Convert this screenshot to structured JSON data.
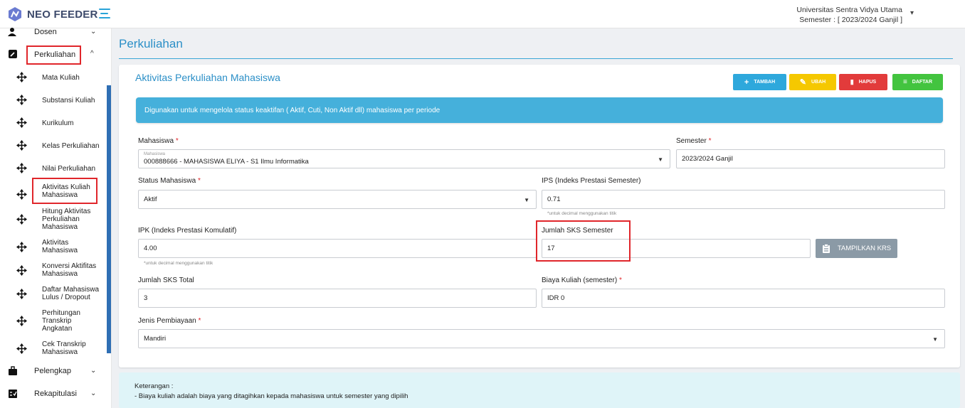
{
  "app": {
    "name": "NEO FEEDER"
  },
  "header": {
    "institution": "Universitas Sentra Vidya Utama",
    "semester": "Semester : [ 2023/2024 Ganjil ]"
  },
  "sidebar": {
    "items": [
      {
        "label": "Dosen",
        "icon": "user-group-icon"
      },
      {
        "label": "Perkuliahan",
        "icon": "edit-square-icon"
      },
      {
        "label": "Pelengkap",
        "icon": "briefcase-icon"
      },
      {
        "label": "Rekapitulasi",
        "icon": "report-icon"
      }
    ],
    "subitems": [
      {
        "label": "Mata Kuliah"
      },
      {
        "label": "Substansi Kuliah"
      },
      {
        "label": "Kurikulum"
      },
      {
        "label": "Kelas Perkuliahan"
      },
      {
        "label": "Nilai Perkuliahan"
      },
      {
        "label": "Aktivitas Kuliah Mahasiswa"
      },
      {
        "label": "Hitung Aktivitas Perkuliahan Mahasiswa"
      },
      {
        "label": "Aktivitas Mahasiswa"
      },
      {
        "label": "Konversi Aktifitas Mahasiswa"
      },
      {
        "label": "Daftar Mahasiswa Lulus / Dropout"
      },
      {
        "label": "Perhitungan Transkrip Angkatan"
      },
      {
        "label": "Cek Transkrip Mahasiswa"
      }
    ]
  },
  "page": {
    "title": "Perkuliahan"
  },
  "card": {
    "title": "Aktivitas Perkuliahan Mahasiswa",
    "buttons": {
      "tambah": "TAMBAH",
      "ubah": "UBAH",
      "hapus": "HAPUS",
      "daftar": "DAFTAR"
    },
    "info": "Digunakan untuk mengelola status keaktifan ( Aktif, Cuti, Non Aktif dll) mahasiswa per periode"
  },
  "form": {
    "mahasiswa": {
      "label": "Mahasiswa",
      "float_label": "Mahasiswa",
      "value": "000888666 - MAHASISWA ELIYA - S1 Ilmu Informatika"
    },
    "semester": {
      "label": "Semester",
      "value": "2023/2024 Ganjil"
    },
    "status": {
      "label": "Status Mahasiswa",
      "value": "Aktif"
    },
    "ips": {
      "label": "IPS (Indeks Prestasi Semester)",
      "value": "0.71",
      "hint": "*untuk decimal menggunakan titik"
    },
    "ipk": {
      "label": "IPK (Indeks Prestasi Komulatif)",
      "value": "4.00",
      "hint": "*untuk decimal menggunakan titik"
    },
    "sks_semester": {
      "label": "Jumlah SKS Semester",
      "value": "17"
    },
    "tampilkan_krs": "TAMPILKAN KRS",
    "sks_total": {
      "label": "Jumlah SKS Total",
      "value": "3"
    },
    "biaya": {
      "label": "Biaya Kuliah (semester)",
      "value": "IDR 0"
    },
    "pembiayaan": {
      "label": "Jenis Pembiayaan",
      "value": "Mandiri"
    }
  },
  "note": {
    "title": "Keterangan :",
    "line1": "- Biaya kuliah adalah biaya yang ditagihkan kepada mahasiswa untuk semester yang dipilih"
  },
  "colors": {
    "accent": "#2b8fc7",
    "tambah": "#2ea8dc",
    "ubah": "#f5c800",
    "hapus": "#e23b3b",
    "daftar": "#43c43f",
    "highlight": "#e0262b"
  }
}
